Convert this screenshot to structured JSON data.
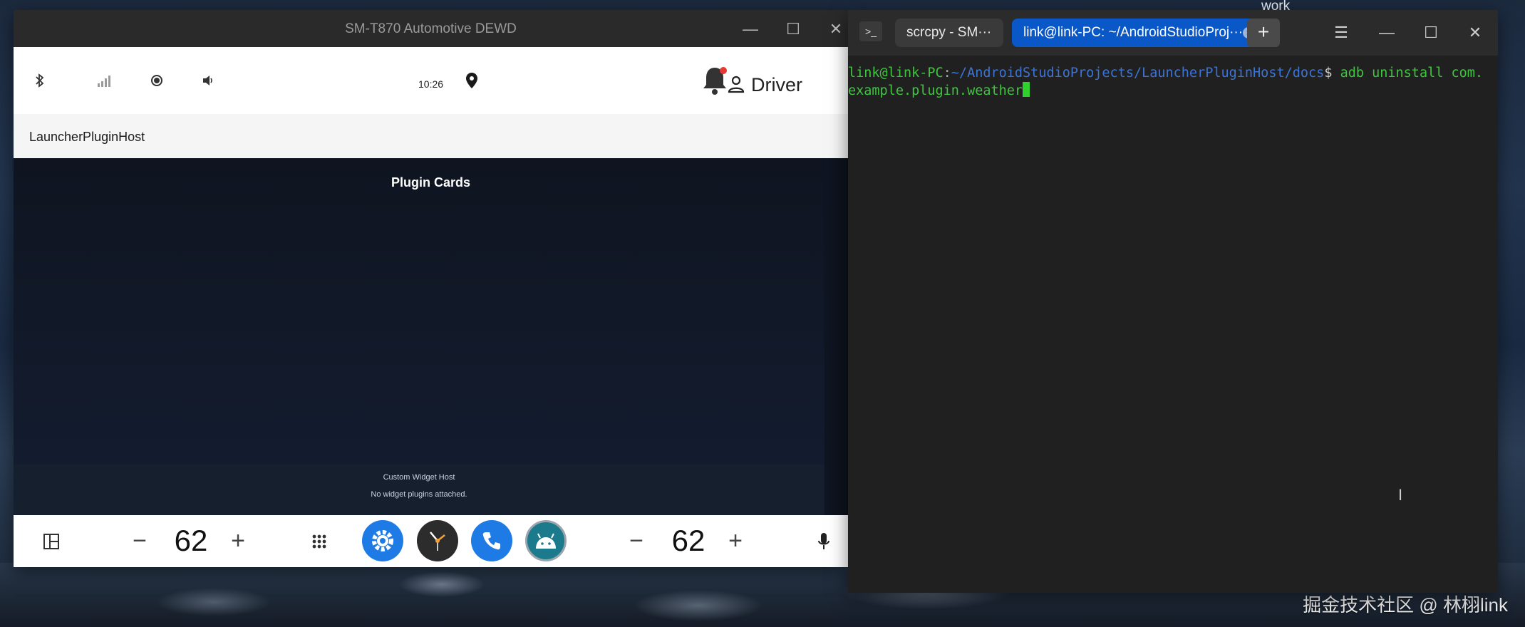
{
  "desktop": {
    "top_label": "work",
    "watermark": "掘金技术社区 @ 林栩link"
  },
  "scrcpy_window": {
    "title": "SM-T870 Automotive DEWD",
    "controls": {
      "minimize": "—",
      "maximize": "☐",
      "close": "✕"
    },
    "status_bar": {
      "time": "10:26",
      "user_label": "Driver"
    },
    "app_bar_title": "LauncherPluginHost",
    "content": {
      "header": "Plugin Cards",
      "widget_host_title": "Custom Widget Host",
      "widget_host_message": "No widget plugins attached."
    },
    "nav_bar": {
      "left_temp": "62",
      "right_temp": "62",
      "minus": "−",
      "plus": "+"
    }
  },
  "terminal_window": {
    "tabs": [
      {
        "label": "scrcpy - SM···"
      },
      {
        "label": "link@link-PC: ~/AndroidStudioProj···"
      }
    ],
    "add_tab": "+",
    "controls": {
      "menu": "☰",
      "minimize": "—",
      "maximize": "☐",
      "close": "✕"
    },
    "prompt_user": "link@link-PC",
    "prompt_sep": ":",
    "prompt_path": "~/AndroidStudioProjects/LauncherPluginHost/docs",
    "prompt_symbol": "$ ",
    "command_line1": "adb uninstall com.",
    "command_line2": "example.plugin.weather"
  }
}
